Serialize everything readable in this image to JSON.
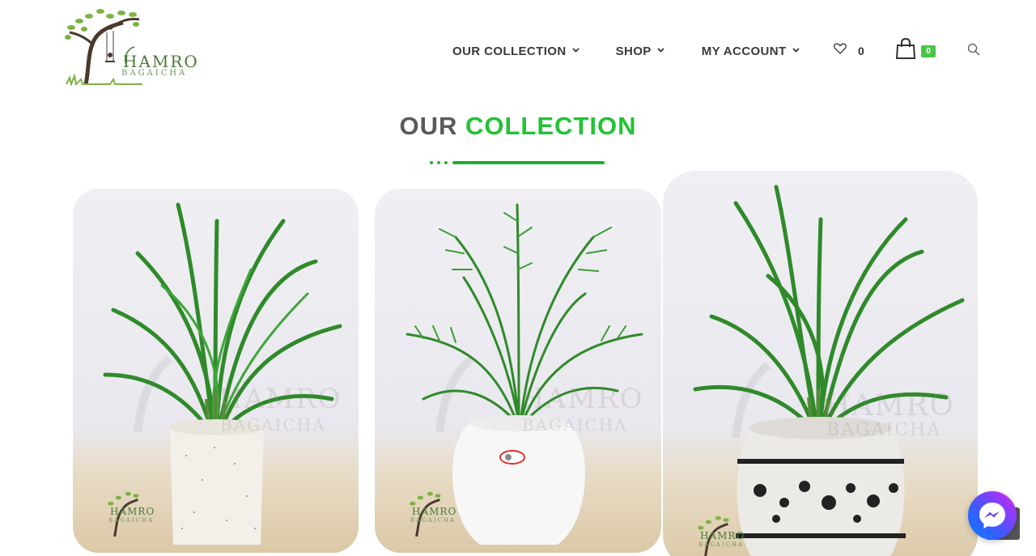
{
  "header": {
    "logo_text_line1": "HAMRO",
    "logo_text_line2": "BAGAICHA",
    "nav": [
      {
        "label": "OUR COLLECTION"
      },
      {
        "label": "SHOP"
      },
      {
        "label": "MY ACCOUNT"
      }
    ],
    "wishlist_count": "0",
    "cart_count": "0"
  },
  "section": {
    "title_part1": "OUR",
    "title_part2": "COLLECTION"
  },
  "colors": {
    "accent": "#22c335",
    "nav_text": "#3a3a3a",
    "title_grey": "#5a5a5a",
    "badge": "#4cc44a"
  },
  "icons": [
    "chevron-down-icon",
    "heart-icon",
    "shopping-bag-icon",
    "search-icon",
    "messenger-icon",
    "scroll-to-top-icon"
  ],
  "products": [
    {
      "watermark_1": "HAMRO",
      "watermark_2": "BAGAICHA",
      "badge_1": "HAMRO",
      "badge_2": "BAGAICHA"
    },
    {
      "watermark_1": "HAMRO",
      "watermark_2": "BAGAICHA",
      "badge_1": "HAMRO",
      "badge_2": "BAGAICHA"
    },
    {
      "watermark_1": "HAMRO",
      "watermark_2": "BAGAICHA",
      "badge_1": "HAMRO",
      "badge_2": "BAGAICHA"
    }
  ]
}
